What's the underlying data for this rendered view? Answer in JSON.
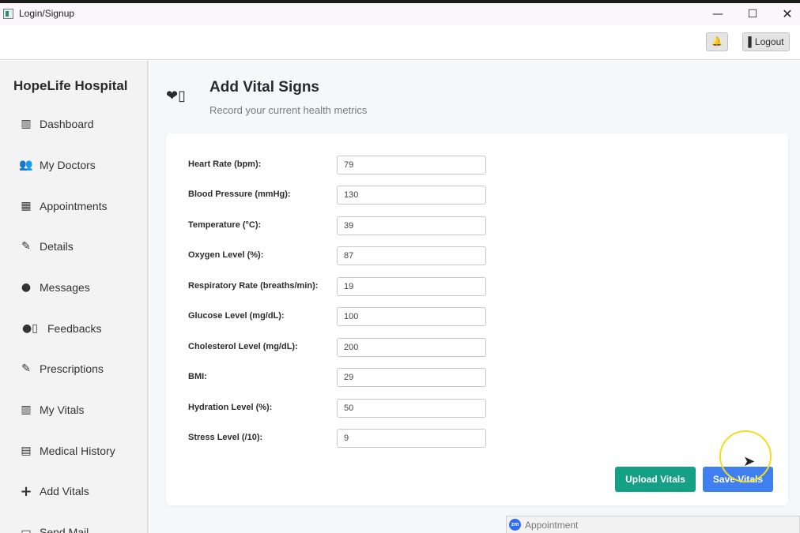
{
  "window": {
    "title": "Login/Signup",
    "minimize_glyph": "—",
    "maximize_glyph": "☐",
    "close_glyph": "✕"
  },
  "toolbar": {
    "notification_icon": "bell-icon",
    "notification_glyph": "🔔",
    "logout_label": "▌Logout"
  },
  "sidebar": {
    "brand": "HopeLife Hospital",
    "items": [
      {
        "label": "Dashboard",
        "icon": "dashboard-icon",
        "glyph": "▥"
      },
      {
        "label": "My Doctors",
        "icon": "doctors-icon",
        "glyph": "👥"
      },
      {
        "label": "Appointments",
        "icon": "calendar-icon",
        "glyph": "▦"
      },
      {
        "label": "Details",
        "icon": "edit-icon",
        "glyph": "✎"
      },
      {
        "label": "Messages",
        "icon": "chat-icon",
        "glyph": "●"
      },
      {
        "label": "Feedbacks",
        "icon": "feedback-icon",
        "glyph": "●▯"
      },
      {
        "label": "Prescriptions",
        "icon": "prescription-icon",
        "glyph": "✎"
      },
      {
        "label": "My Vitals",
        "icon": "vitals-icon",
        "glyph": "▥"
      },
      {
        "label": "Medical History",
        "icon": "scroll-icon",
        "glyph": "▤"
      },
      {
        "label": "Add Vitals",
        "icon": "plus-icon",
        "glyph": "+"
      },
      {
        "label": "Send Mail",
        "icon": "mail-icon",
        "glyph": "▭"
      }
    ]
  },
  "header": {
    "icon_glyph": "❤▯",
    "title": "Add Vital Signs",
    "subtitle": "Record your current health metrics"
  },
  "form": {
    "fields": [
      {
        "label": "Heart Rate (bpm):",
        "value": "79"
      },
      {
        "label": "Blood Pressure (mmHg):",
        "value": "130"
      },
      {
        "label": "Temperature (°C):",
        "value": "39"
      },
      {
        "label": "Oxygen Level (%):",
        "value": "87"
      },
      {
        "label": "Respiratory Rate (breaths/min):",
        "value": "19"
      },
      {
        "label": "Glucose Level (mg/dL):",
        "value": "100"
      },
      {
        "label": "Cholesterol Level (mg/dL):",
        "value": "200"
      },
      {
        "label": "BMI:",
        "value": "29"
      },
      {
        "label": "Hydration Level (%):",
        "value": "50"
      },
      {
        "label": "Stress Level (/10):",
        "value": "9"
      }
    ],
    "upload_label": "Upload Vitals",
    "save_label": "Save Vitals"
  },
  "taskbar": {
    "app_badge": "zm",
    "label": "Appointment"
  },
  "colors": {
    "upload_button": "#14a085",
    "save_button": "#3f7ff0",
    "cursor_highlight": "#f3dc22"
  }
}
